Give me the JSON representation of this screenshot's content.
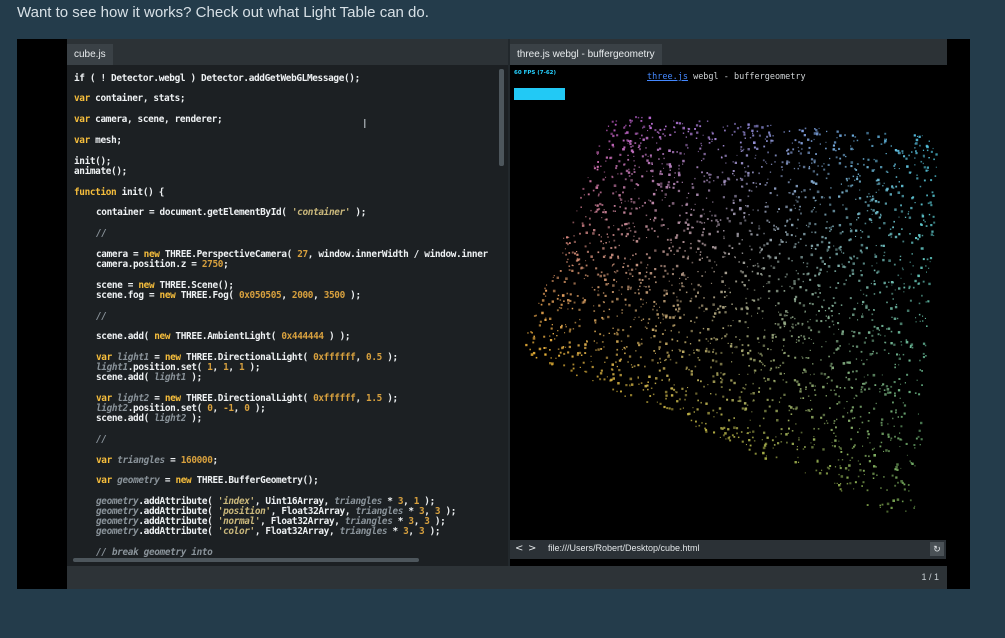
{
  "intro_text": "Want to see how it works? Check out what Light Table can do.",
  "editor": {
    "tab_label": "cube.js"
  },
  "browser": {
    "tab_label": "three.js webgl - buffergeometry",
    "fps_label": "60 FPS (7-62)",
    "demo_title_link": "three.js",
    "demo_title_rest": " webgl - buffergeometry",
    "back_label": "<",
    "forward_label": ">",
    "url": "file:///Users/Robert/Desktop/cube.html",
    "refresh_label": "↻"
  },
  "status": {
    "page_indicator": "1 / 1"
  },
  "colors": {
    "page_background": "#243c4b",
    "keyword": "#f5bd3c",
    "string": "#c9b77b",
    "fps_accent": "#22c9f5"
  },
  "code_lines": [
    {
      "t": 0,
      "i": 0,
      "segs": [
        [
          "p",
          "if ( ! Detector.webgl ) Detector.addGetWebGLMessage();"
        ]
      ]
    },
    {
      "t": 20,
      "i": 0,
      "segs": [
        [
          "k",
          "var"
        ],
        [
          "p",
          " container, stats;"
        ]
      ]
    },
    {
      "t": 41,
      "i": 0,
      "segs": [
        [
          "k",
          "var"
        ],
        [
          "p",
          " camera, scene, renderer;"
        ]
      ]
    },
    {
      "t": 62,
      "i": 0,
      "segs": [
        [
          "k",
          "var"
        ],
        [
          "p",
          " mesh;"
        ]
      ]
    },
    {
      "t": 83,
      "i": 0,
      "segs": [
        [
          "p",
          "init();"
        ]
      ]
    },
    {
      "t": 93,
      "i": 0,
      "segs": [
        [
          "p",
          "animate();"
        ]
      ]
    },
    {
      "t": 114,
      "i": 0,
      "segs": [
        [
          "k",
          "function"
        ],
        [
          "p",
          " init() {"
        ]
      ]
    },
    {
      "t": 134,
      "i": 22,
      "segs": [
        [
          "p",
          "container = document.getElementById( "
        ],
        [
          "s",
          "'container'"
        ],
        [
          "p",
          " );"
        ]
      ]
    },
    {
      "t": 155,
      "i": 22,
      "segs": [
        [
          "d",
          "//"
        ]
      ]
    },
    {
      "t": 176,
      "i": 22,
      "segs": [
        [
          "p",
          "camera = "
        ],
        [
          "k",
          "new"
        ],
        [
          "p",
          " THREE.PerspectiveCamera( "
        ],
        [
          "n",
          "27"
        ],
        [
          "p",
          ", window.innerWidth / window.inner"
        ]
      ]
    },
    {
      "t": 186,
      "i": 22,
      "segs": [
        [
          "p",
          "camera.position.z = "
        ],
        [
          "n",
          "2750"
        ],
        [
          "p",
          ";"
        ]
      ]
    },
    {
      "t": 207,
      "i": 22,
      "segs": [
        [
          "p",
          "scene = "
        ],
        [
          "k",
          "new"
        ],
        [
          "p",
          " THREE.Scene();"
        ]
      ]
    },
    {
      "t": 217,
      "i": 22,
      "segs": [
        [
          "p",
          "scene.fog = "
        ],
        [
          "k",
          "new"
        ],
        [
          "p",
          " THREE.Fog( "
        ],
        [
          "n",
          "0x050505"
        ],
        [
          "p",
          ", "
        ],
        [
          "n",
          "2000"
        ],
        [
          "p",
          ", "
        ],
        [
          "n",
          "3500"
        ],
        [
          "p",
          " );"
        ]
      ]
    },
    {
      "t": 238,
      "i": 22,
      "segs": [
        [
          "d",
          "//"
        ]
      ]
    },
    {
      "t": 258,
      "i": 22,
      "segs": [
        [
          "p",
          "scene.add( "
        ],
        [
          "k",
          "new"
        ],
        [
          "p",
          " THREE.AmbientLight( "
        ],
        [
          "n",
          "0x444444"
        ],
        [
          "p",
          " ) );"
        ]
      ]
    },
    {
      "t": 279,
      "i": 22,
      "segs": [
        [
          "k",
          "var"
        ],
        [
          "d",
          " light1"
        ],
        [
          "p",
          " = "
        ],
        [
          "k",
          "new"
        ],
        [
          "p",
          " THREE.DirectionalLight( "
        ],
        [
          "n",
          "0xffffff"
        ],
        [
          "p",
          ", "
        ],
        [
          "n",
          "0.5"
        ],
        [
          "p",
          " );"
        ]
      ]
    },
    {
      "t": 289,
      "i": 22,
      "segs": [
        [
          "d",
          "light1"
        ],
        [
          "p",
          ".position.set( "
        ],
        [
          "n",
          "1"
        ],
        [
          "p",
          ", "
        ],
        [
          "n",
          "1"
        ],
        [
          "p",
          ", "
        ],
        [
          "n",
          "1"
        ],
        [
          "p",
          " );"
        ]
      ]
    },
    {
      "t": 299,
      "i": 22,
      "segs": [
        [
          "p",
          "scene.add( "
        ],
        [
          "d",
          "light1"
        ],
        [
          "p",
          " );"
        ]
      ]
    },
    {
      "t": 320,
      "i": 22,
      "segs": [
        [
          "k",
          "var"
        ],
        [
          "d",
          " light2"
        ],
        [
          "p",
          " = "
        ],
        [
          "k",
          "new"
        ],
        [
          "p",
          " THREE.DirectionalLight( "
        ],
        [
          "n",
          "0xffffff"
        ],
        [
          "p",
          ", "
        ],
        [
          "n",
          "1.5"
        ],
        [
          "p",
          " );"
        ]
      ]
    },
    {
      "t": 330,
      "i": 22,
      "segs": [
        [
          "d",
          "light2"
        ],
        [
          "p",
          ".position.set( "
        ],
        [
          "n",
          "0"
        ],
        [
          "p",
          ", "
        ],
        [
          "n",
          "-1"
        ],
        [
          "p",
          ", "
        ],
        [
          "n",
          "0"
        ],
        [
          "p",
          " );"
        ]
      ]
    },
    {
      "t": 340,
      "i": 22,
      "segs": [
        [
          "p",
          "scene.add( "
        ],
        [
          "d",
          "light2"
        ],
        [
          "p",
          " );"
        ]
      ]
    },
    {
      "t": 361,
      "i": 22,
      "segs": [
        [
          "d",
          "//"
        ]
      ]
    },
    {
      "t": 382,
      "i": 22,
      "segs": [
        [
          "k",
          "var"
        ],
        [
          "d",
          " triangles"
        ],
        [
          "p",
          " = "
        ],
        [
          "n",
          "160000"
        ],
        [
          "p",
          ";"
        ]
      ]
    },
    {
      "t": 402,
      "i": 22,
      "segs": [
        [
          "k",
          "var"
        ],
        [
          "d",
          " geometry"
        ],
        [
          "p",
          " = "
        ],
        [
          "k",
          "new"
        ],
        [
          "p",
          " THREE.BufferGeometry();"
        ]
      ]
    },
    {
      "t": 423,
      "i": 22,
      "segs": [
        [
          "d",
          "geometry"
        ],
        [
          "p",
          ".addAttribute( "
        ],
        [
          "s",
          "'index'"
        ],
        [
          "p",
          ", Uint16Array, "
        ],
        [
          "d",
          "triangles"
        ],
        [
          "p",
          " * "
        ],
        [
          "n",
          "3"
        ],
        [
          "p",
          ", "
        ],
        [
          "n",
          "1"
        ],
        [
          "p",
          " );"
        ]
      ]
    },
    {
      "t": 433,
      "i": 22,
      "segs": [
        [
          "d",
          "geometry"
        ],
        [
          "p",
          ".addAttribute( "
        ],
        [
          "s",
          "'position'"
        ],
        [
          "p",
          ", Float32Array, "
        ],
        [
          "d",
          "triangles"
        ],
        [
          "p",
          " * "
        ],
        [
          "n",
          "3"
        ],
        [
          "p",
          ", "
        ],
        [
          "n",
          "3"
        ],
        [
          "p",
          " );"
        ]
      ]
    },
    {
      "t": 443,
      "i": 22,
      "segs": [
        [
          "d",
          "geometry"
        ],
        [
          "p",
          ".addAttribute( "
        ],
        [
          "s",
          "'normal'"
        ],
        [
          "p",
          ", Float32Array, "
        ],
        [
          "d",
          "triangles"
        ],
        [
          "p",
          " * "
        ],
        [
          "n",
          "3"
        ],
        [
          "p",
          ", "
        ],
        [
          "n",
          "3"
        ],
        [
          "p",
          " );"
        ]
      ]
    },
    {
      "t": 453,
      "i": 22,
      "segs": [
        [
          "d",
          "geometry"
        ],
        [
          "p",
          ".addAttribute( "
        ],
        [
          "s",
          "'color'"
        ],
        [
          "p",
          ", Float32Array, "
        ],
        [
          "d",
          "triangles"
        ],
        [
          "p",
          " * "
        ],
        [
          "n",
          "3"
        ],
        [
          "p",
          ", "
        ],
        [
          "n",
          "3"
        ],
        [
          "p",
          " );"
        ]
      ]
    },
    {
      "t": 474,
      "i": 22,
      "segs": [
        [
          "d",
          "// break geometry into"
        ]
      ]
    }
  ]
}
